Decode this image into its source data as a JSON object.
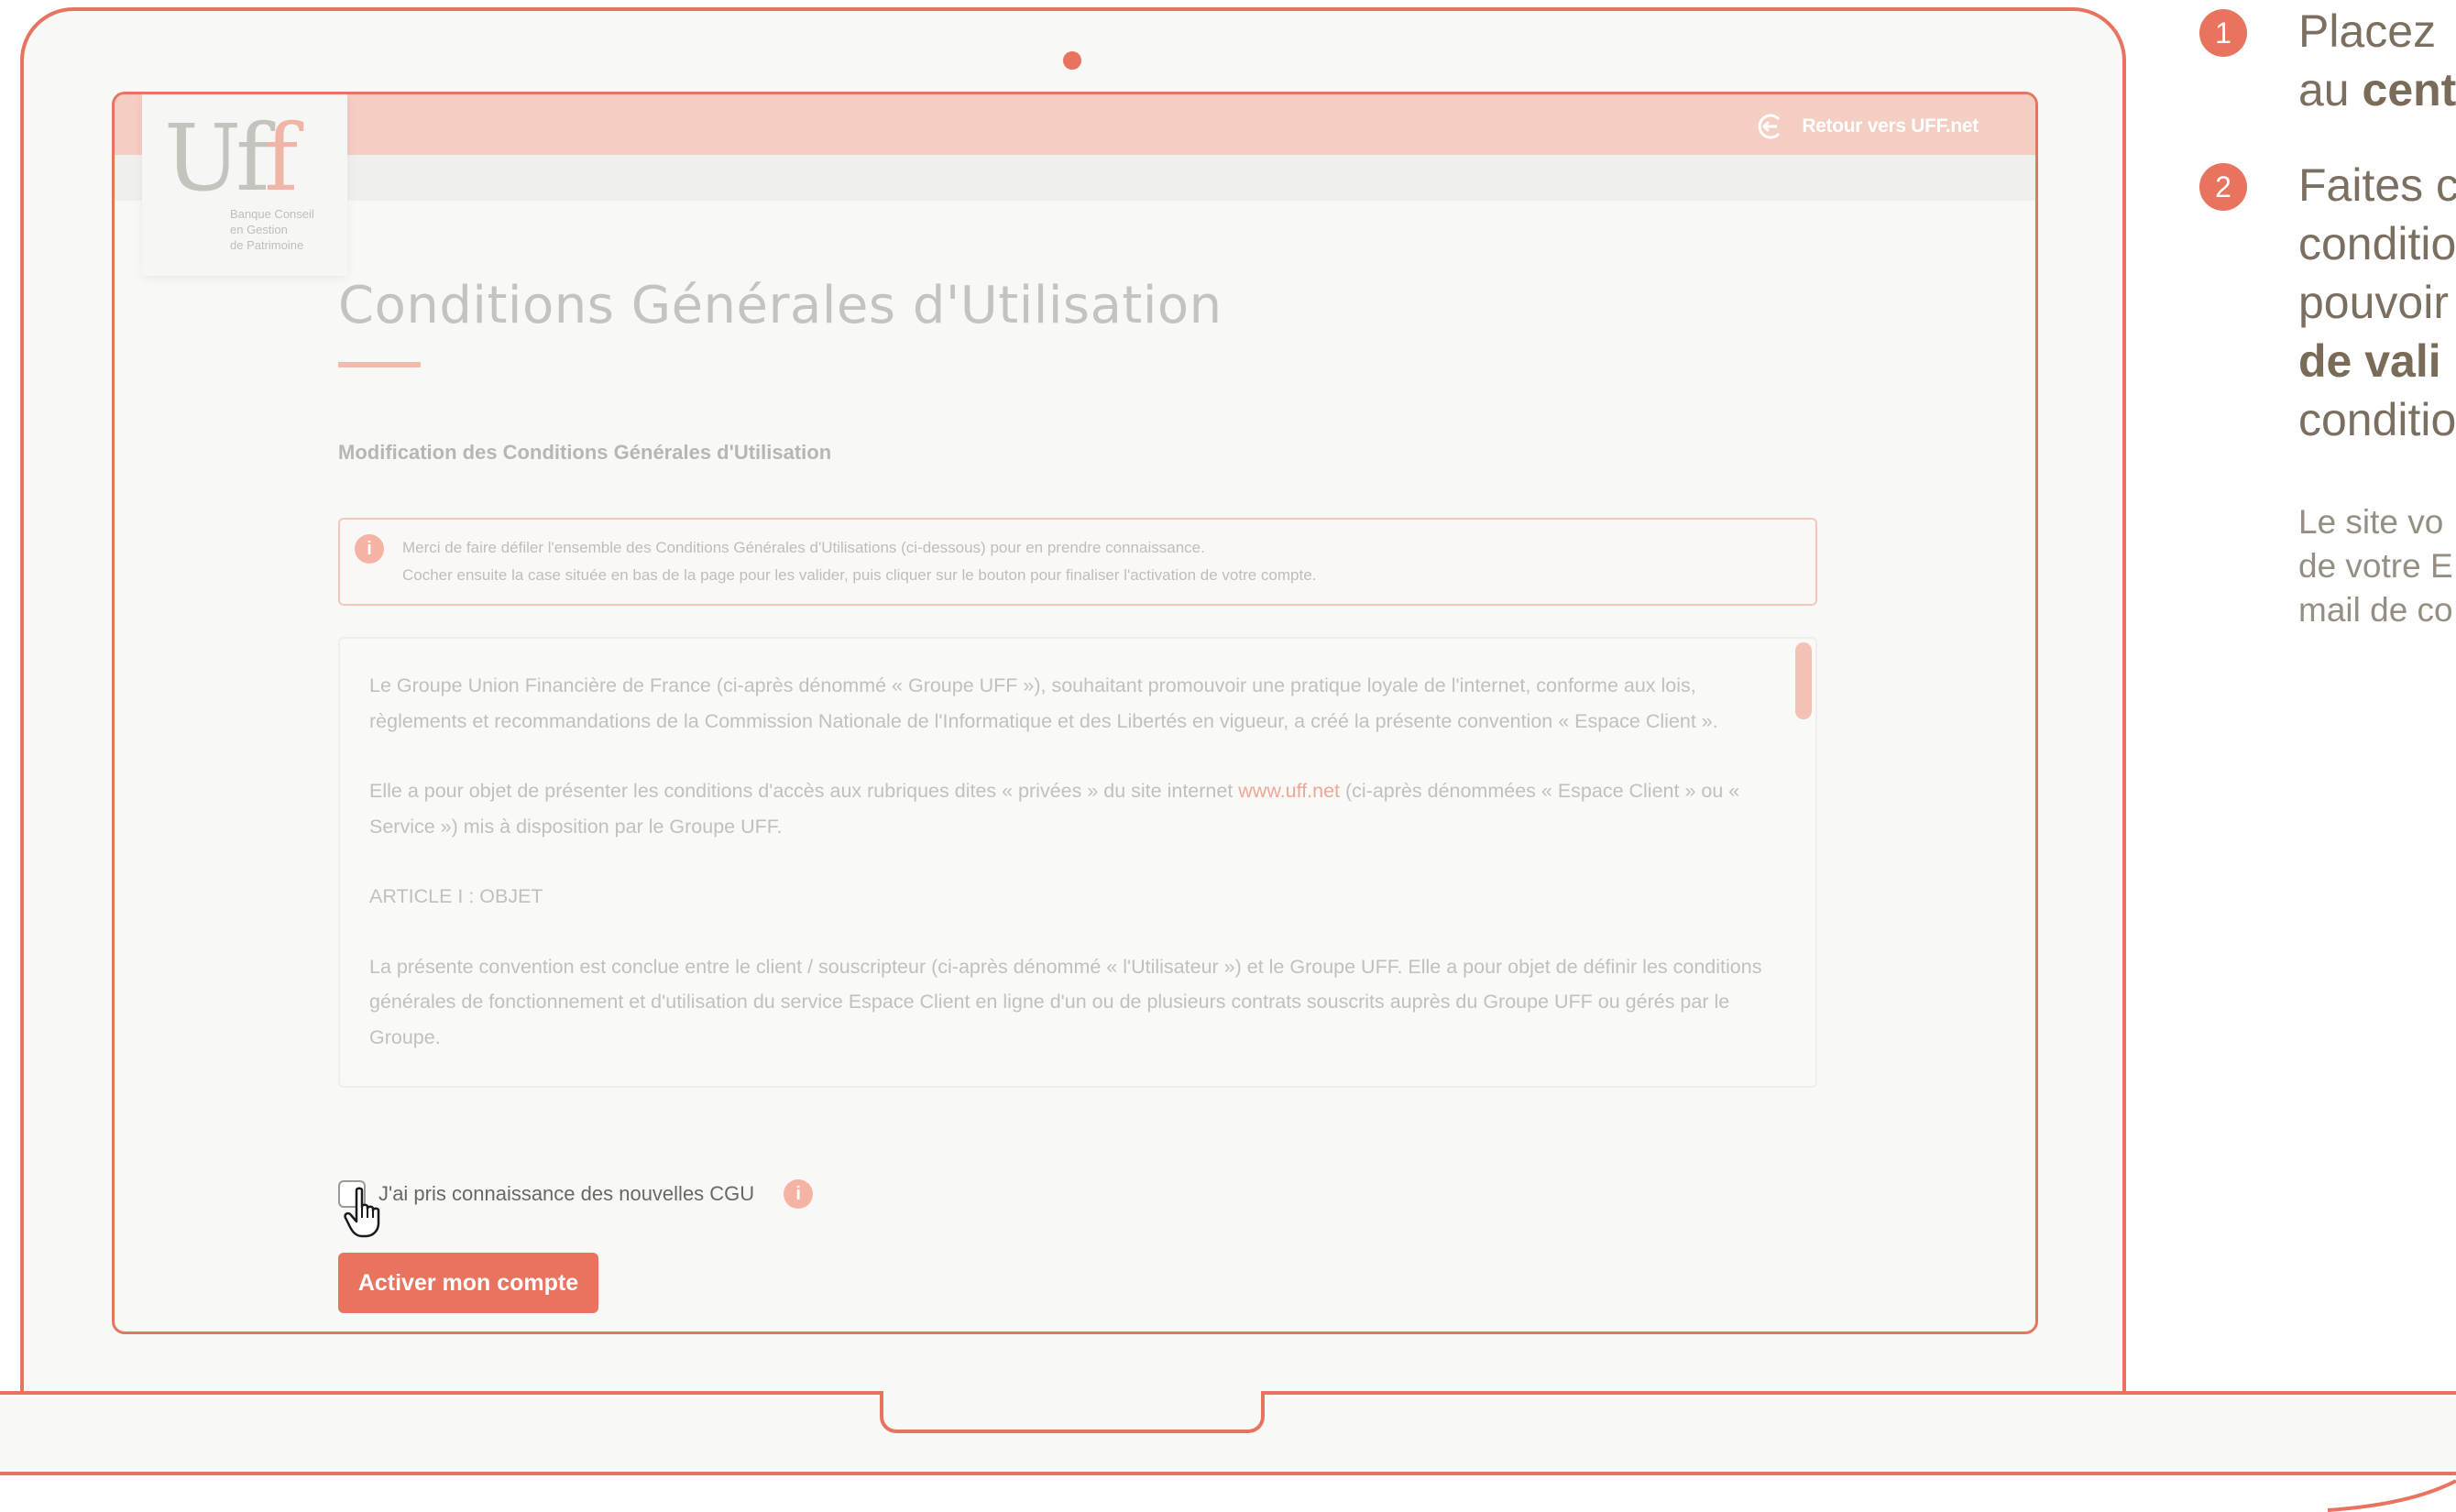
{
  "screen": {
    "back_link_label": "Retour vers UFF.net",
    "logo": {
      "mark_u": "U",
      "mark_f1": "f",
      "mark_f2": "f",
      "tagline": "Banque Conseil\nen Gestion\nde Patrimoine"
    },
    "page_title": "Conditions Générales d'Utilisation",
    "section_heading": "Modification des Conditions Générales d'Utilisation",
    "info_box": {
      "line1": "Merci de faire défiler l'ensemble des Conditions Générales d'Utilisations (ci-dessous) pour en prendre connaissance.",
      "line2": "Cocher ensuite la case située en bas de la page pour les valider, puis cliquer sur le bouton pour finaliser l'activation de votre compte."
    },
    "cgu": {
      "para1": "Le Groupe Union Financière de France (ci-après dénommé « Groupe UFF »), souhaitant promouvoir une pratique loyale de l'internet, conforme aux lois, règlements et recommandations de la Commission Nationale de l'Informatique et des Libertés en vigueur, a créé la présente convention « Espace Client ».",
      "para2_before": "Elle a pour objet de présenter les conditions d'accès aux rubriques dites « privées » du site internet ",
      "para2_link": "www.uff.net",
      "para2_after": " (ci-après dénommées « Espace Client » ou « Service ») mis à disposition par le Groupe UFF.",
      "article_heading": "ARTICLE I : OBJET",
      "para3": "La présente convention est conclue entre le client / souscripteur (ci-après dénommé « l'Utilisateur ») et le Groupe UFF. Elle a pour objet de définir les conditions générales de fonctionnement et d'utilisation du service Espace Client en ligne d'un ou de plusieurs contrats souscrits auprès du Groupe UFF ou gérés par le Groupe."
    },
    "checkbox_label": "J'ai pris connaissance des nouvelles CGU",
    "checkbox_checked": false,
    "info_icon_glyph": "i",
    "activate_button": "Activer mon compte"
  },
  "instructions": {
    "step1": {
      "number": "1",
      "line1": "Placez",
      "line2_prefix": "au ",
      "line2_bold": "cent"
    },
    "step2": {
      "number": "2",
      "line1": "Faites c",
      "line2": "conditio",
      "line3": "pouvoir",
      "line4_bold": "de vali",
      "line5": "conditio"
    },
    "note": {
      "line1": "Le site vo",
      "line2": "de votre E",
      "line3": "mail de co"
    }
  },
  "icons": {
    "back": "arrow-left-circle-icon",
    "info": "info-icon",
    "cursor": "hand-pointer-icon"
  },
  "colors": {
    "accent": "#e8745f",
    "top_bar": "#f4cdc3",
    "text_brown": "#7a6f60"
  }
}
